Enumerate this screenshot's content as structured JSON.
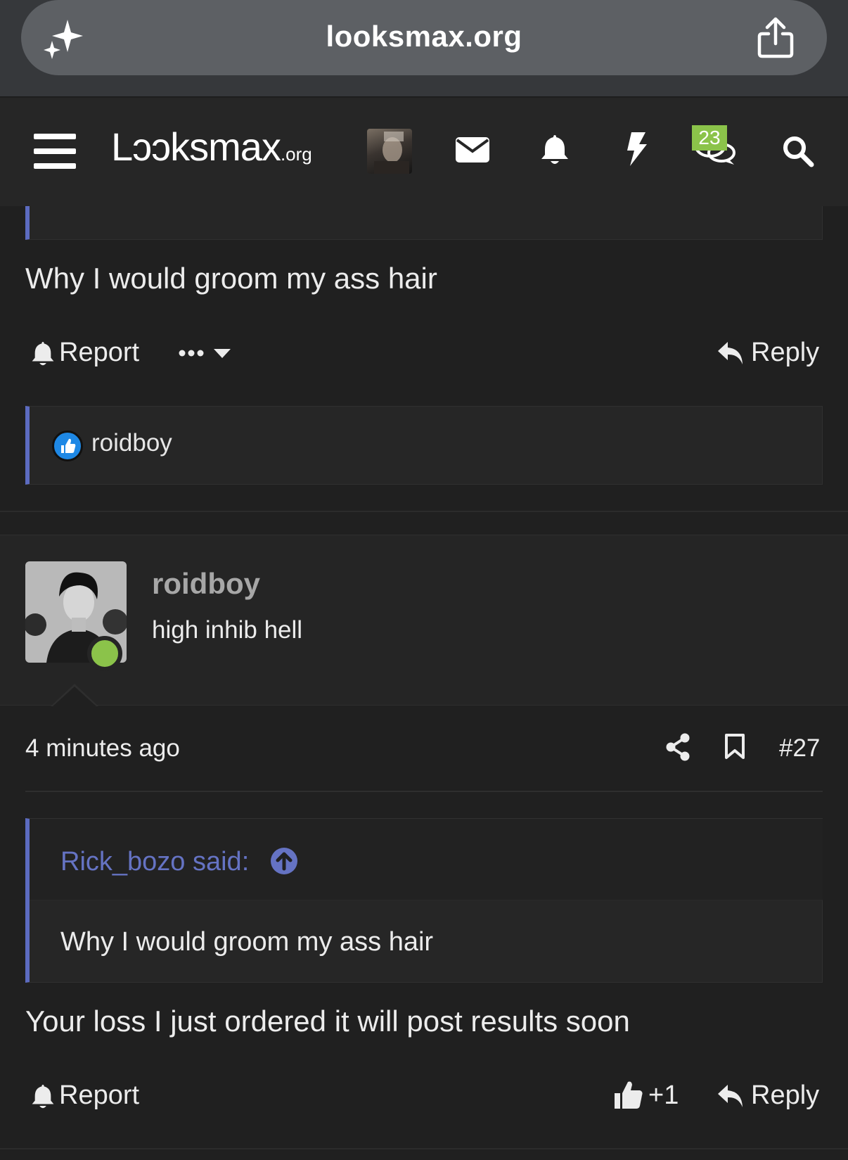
{
  "browser": {
    "url": "looksmax.org"
  },
  "header": {
    "logo_main": "Lɔɔksmax",
    "logo_suffix": ".org",
    "conversations_badge": "23"
  },
  "previous_post": {
    "body": "Why I would groom my ass hair",
    "report_label": "Report",
    "reply_label": "Reply",
    "reactions": [
      "roidboy"
    ]
  },
  "post": {
    "username": "roidboy",
    "user_title": "high inhib hell",
    "time": "4 minutes ago",
    "number": "#27",
    "quote": {
      "author_line": "Rick_bozo said:",
      "text": "Why I would groom my ass hair"
    },
    "body": "Your loss I just ordered it will post results soon",
    "report_label": "Report",
    "like_count": "+1",
    "reply_label": "Reply"
  },
  "colors": {
    "accent": "#5c6bc0",
    "online": "#8bc34a",
    "like": "#1e88e5"
  }
}
